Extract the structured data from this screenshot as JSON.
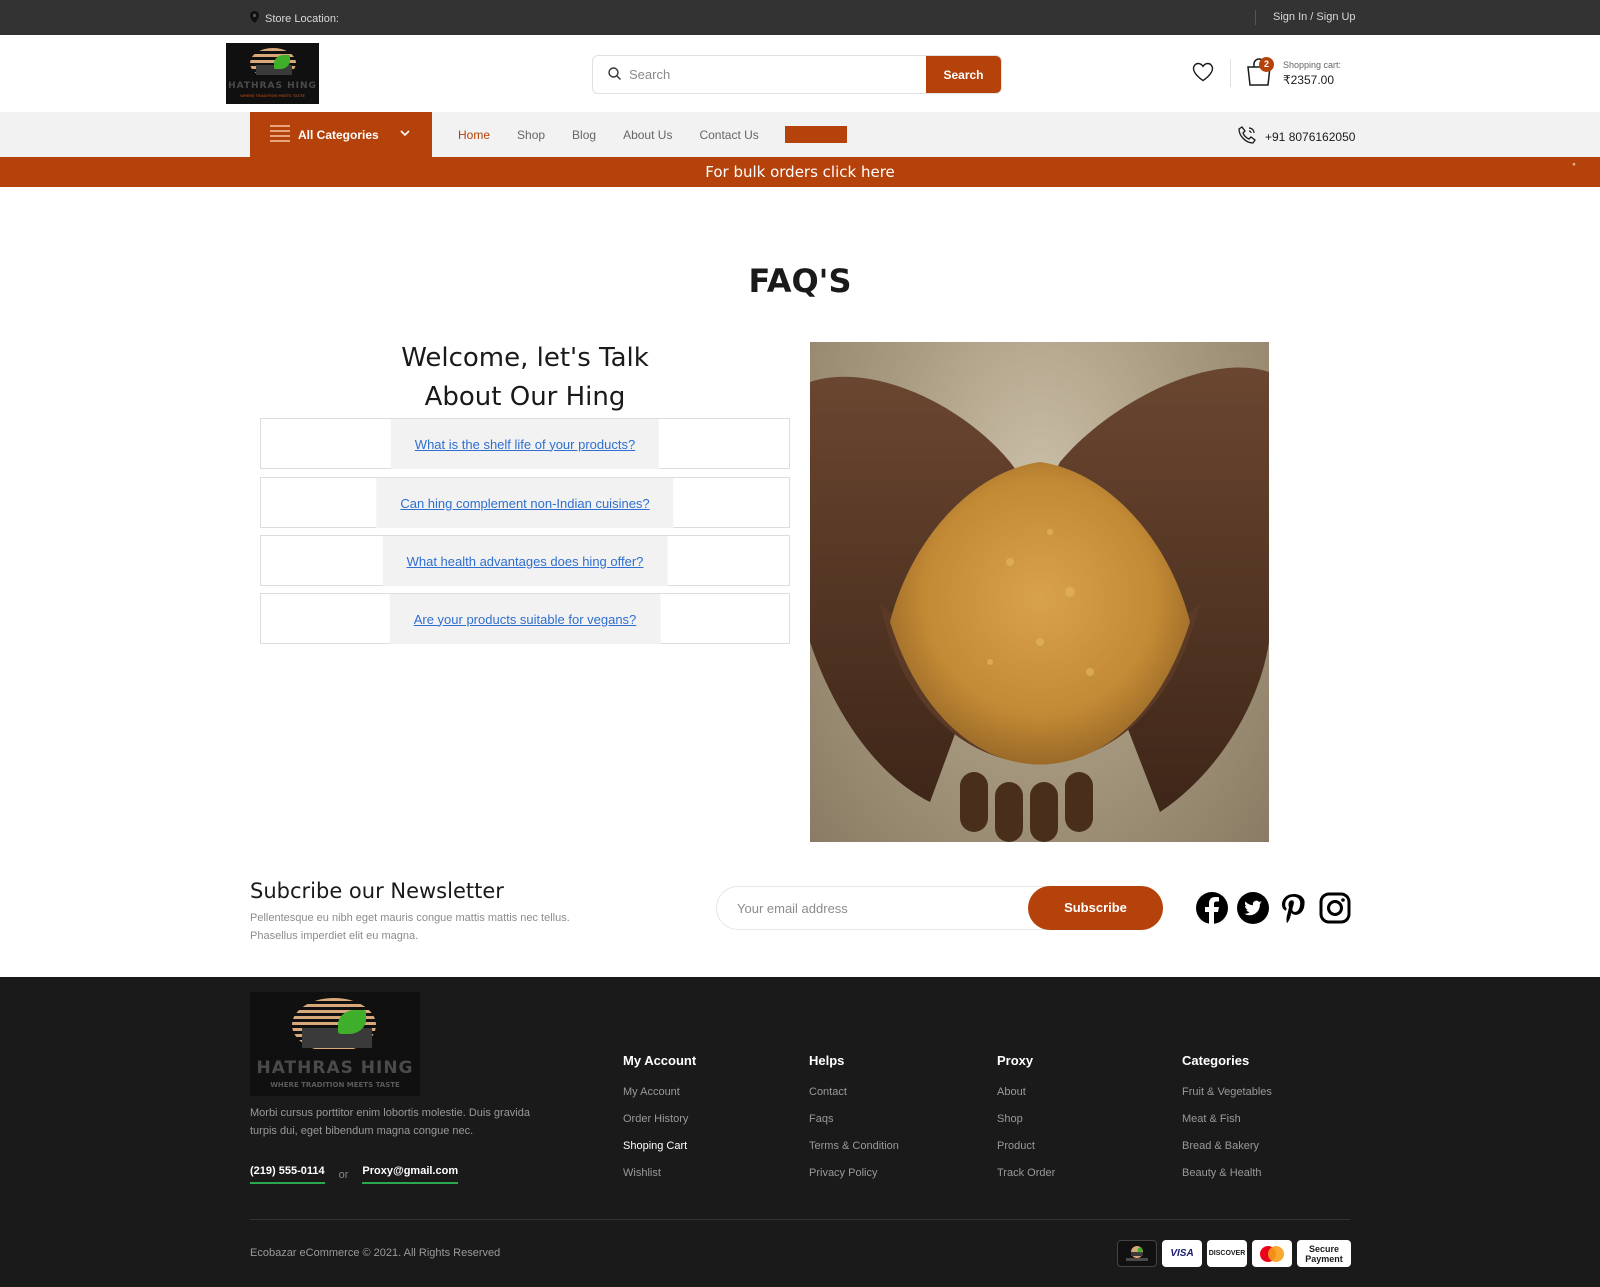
{
  "topbar": {
    "store_location": "Store Location:",
    "sign_in": "Sign In / Sign Up"
  },
  "header": {
    "logo": {
      "brand": "HATHRAS HING",
      "tagline": "WHERE TRADITION MEETS TASTE"
    },
    "search": {
      "placeholder": "Search",
      "button": "Search"
    },
    "cart": {
      "count": "2",
      "label": "Shopping cart:",
      "total": "₹2357.00"
    }
  },
  "nav": {
    "all_categories": "All Categories",
    "links": [
      "Home",
      "Shop",
      "Blog",
      "About Us",
      "Contact Us"
    ],
    "phone": "+91 8076162050"
  },
  "banner": {
    "text": "For bulk orders click here",
    "dot": "°"
  },
  "faq": {
    "title": "FAQ'S",
    "welcome_line1": "Welcome, let's Talk",
    "welcome_line2": "About Our Hing",
    "questions": [
      "What is the shelf life of your products?",
      "Can hing complement non-Indian cuisines?",
      "What health advantages does hing offer?",
      "Are your products suitable for vegans?"
    ]
  },
  "newsletter": {
    "title": "Subcribe our Newsletter",
    "description": "Pellentesque eu nibh eget mauris congue mattis mattis nec tellus. Phasellus imperdiet elit eu magna.",
    "placeholder": "Your email address",
    "button": "Subscribe"
  },
  "footer": {
    "description": "Morbi cursus porttitor enim lobortis molestie. Duis gravida turpis dui, eget bibendum magna congue nec.",
    "phone": "(219) 555-0114",
    "or": "or",
    "email": "Proxy@gmail.com",
    "columns": [
      {
        "title": "My Account",
        "links": [
          "My Account",
          "Order History",
          "Shoping Cart",
          "Wishlist"
        ]
      },
      {
        "title": "Helps",
        "links": [
          "Contact",
          "Faqs",
          "Terms & Condition",
          "Privacy Policy"
        ]
      },
      {
        "title": "Proxy",
        "links": [
          "About",
          "Shop",
          "Product",
          "Track Order"
        ]
      },
      {
        "title": "Categories",
        "links": [
          "Fruit & Vegetables",
          "Meat & Fish",
          "Bread & Bakery",
          "Beauty & Health"
        ]
      }
    ],
    "copyright": "Ecobazar eCommerce © 2021. All Rights Reserved",
    "payments": {
      "visa": "VISA",
      "discover": "DISCOVER",
      "secure_line1": "Secure",
      "secure_line2": "Payment"
    }
  },
  "colors": {
    "accent": "#b5420a",
    "topbar": "#333333",
    "footer": "#1a1a1a",
    "link": "#2f6fd0"
  }
}
